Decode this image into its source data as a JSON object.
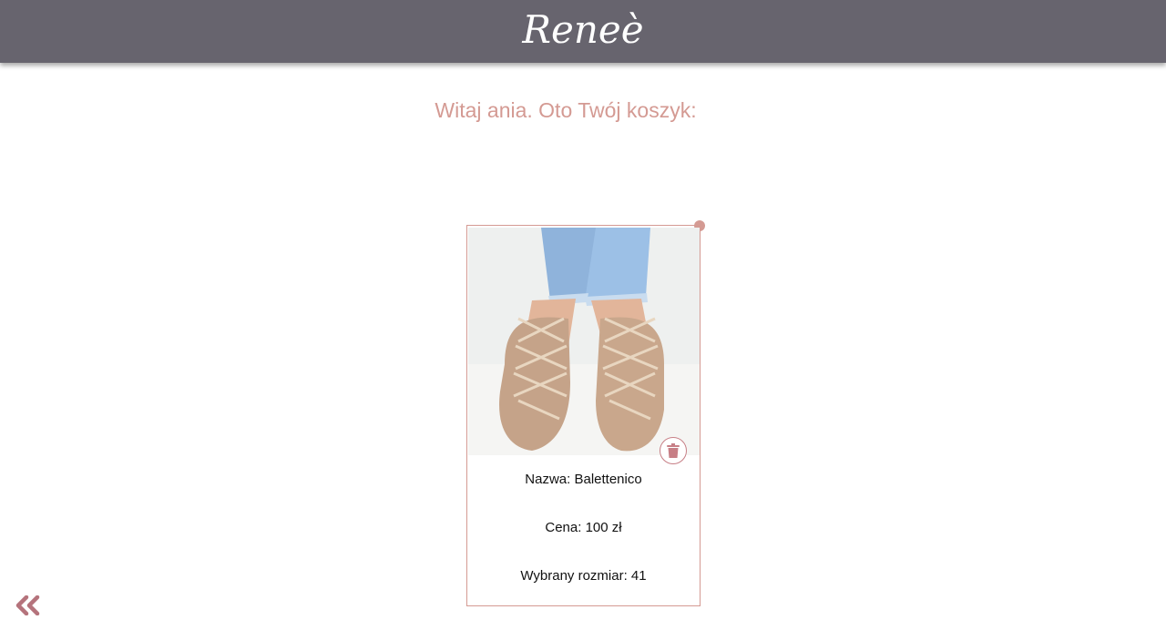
{
  "header": {
    "logo": "Reneè"
  },
  "main": {
    "greeting": "Witaj ania. Oto Twój koszyk:"
  },
  "cart": {
    "items": [
      {
        "name_line": "Nazwa: Balettenico",
        "price_line": "Cena: 100 zł",
        "size_line": "Wybrany rozmiar: 41",
        "delete_icon": "trash-icon"
      }
    ]
  },
  "footer": {
    "back_icon": "double-chevron-left-icon"
  },
  "colors": {
    "header_bg": "#67646e",
    "accent": "#d49a93",
    "back_icon": "#b5737c"
  }
}
